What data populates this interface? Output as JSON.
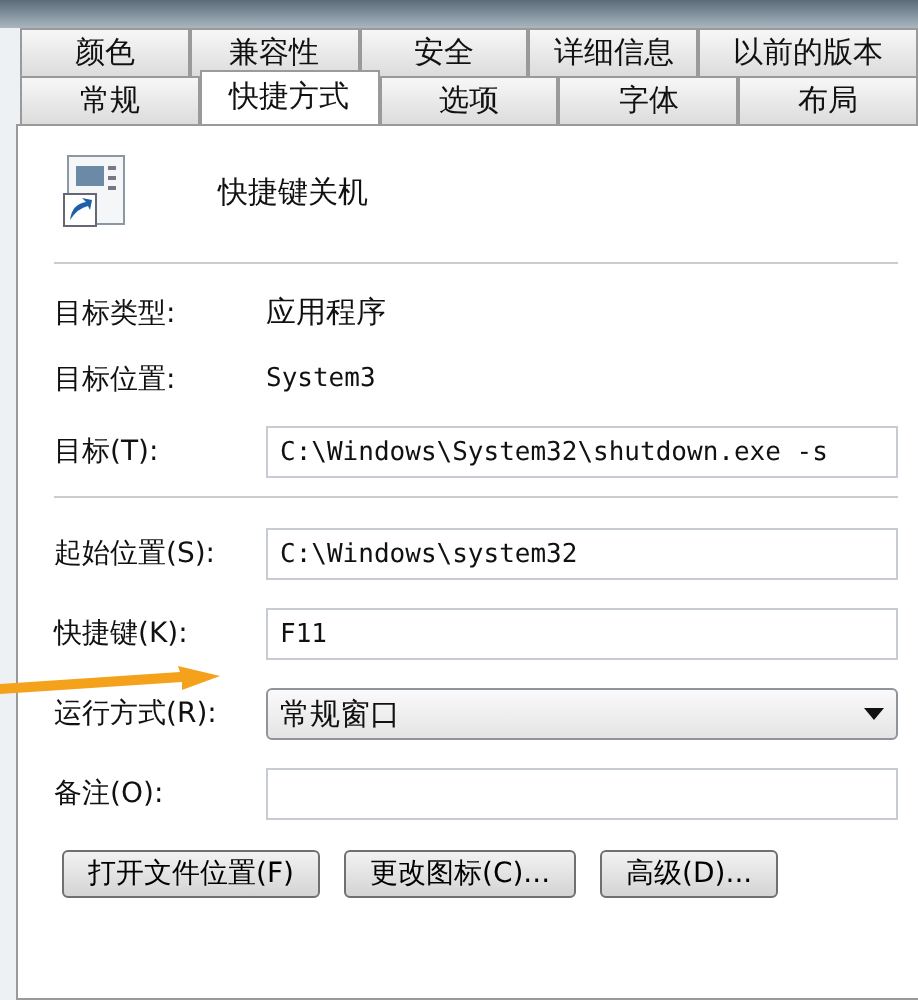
{
  "tabs_back_row": [
    {
      "label": "颜色",
      "selected": false
    },
    {
      "label": "兼容性",
      "selected": false
    },
    {
      "label": "安全",
      "selected": false
    },
    {
      "label": "详细信息",
      "selected": false
    },
    {
      "label": "以前的版本",
      "selected": false
    }
  ],
  "tabs_front_row": [
    {
      "label": "常规",
      "selected": false
    },
    {
      "label": "快捷方式",
      "selected": true
    },
    {
      "label": "选项",
      "selected": false
    },
    {
      "label": "字体",
      "selected": false
    },
    {
      "label": "布局",
      "selected": false
    }
  ],
  "shortcut_name": "快捷键关机",
  "info": [
    {
      "label": "目标类型:",
      "value": "应用程序"
    },
    {
      "label": "目标位置:",
      "value": "System3"
    }
  ],
  "target": {
    "label": "目标(T):",
    "value": "C:\\Windows\\System32\\shutdown.exe -s"
  },
  "fields": [
    {
      "kind": "text",
      "label": "起始位置(S):",
      "value": "C:\\Windows\\system32"
    },
    {
      "kind": "text",
      "label": "快捷键(K):",
      "value": "F11"
    },
    {
      "kind": "select",
      "label": "运行方式(R):",
      "value": "常规窗口"
    },
    {
      "kind": "text",
      "label": "备注(O):"
    }
  ],
  "buttons": [
    "打开文件位置(F)",
    "更改图标(C)...",
    "高级(D)..."
  ]
}
